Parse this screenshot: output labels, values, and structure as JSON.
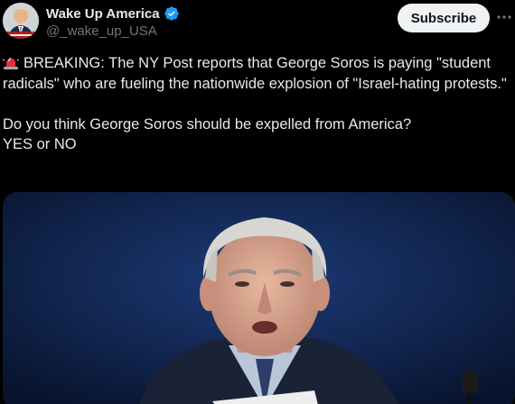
{
  "account": {
    "display_name": "Wake Up America",
    "handle": "@_wake_up_USA",
    "avatar_icon": "trump-portrait-avatar",
    "verified_icon": "verified-badge-icon",
    "verified_color": "#1d9bf0"
  },
  "actions": {
    "subscribe_label": "Subscribe",
    "more_icon": "more-horizontal-icon"
  },
  "tweet": {
    "siren_icon": "rotating-light-emoji",
    "paragraph1": "BREAKING: The NY Post reports that George Soros is paying \"student radicals\" who are fueling the nationwide explosion of \"Israel-hating protests.\"",
    "line2": "Do you think George Soros should be expelled from America?",
    "line3": "YES or NO"
  },
  "media": {
    "image_subject": "photo-of-george-soros-speaking",
    "background_color": "#0b1738"
  }
}
